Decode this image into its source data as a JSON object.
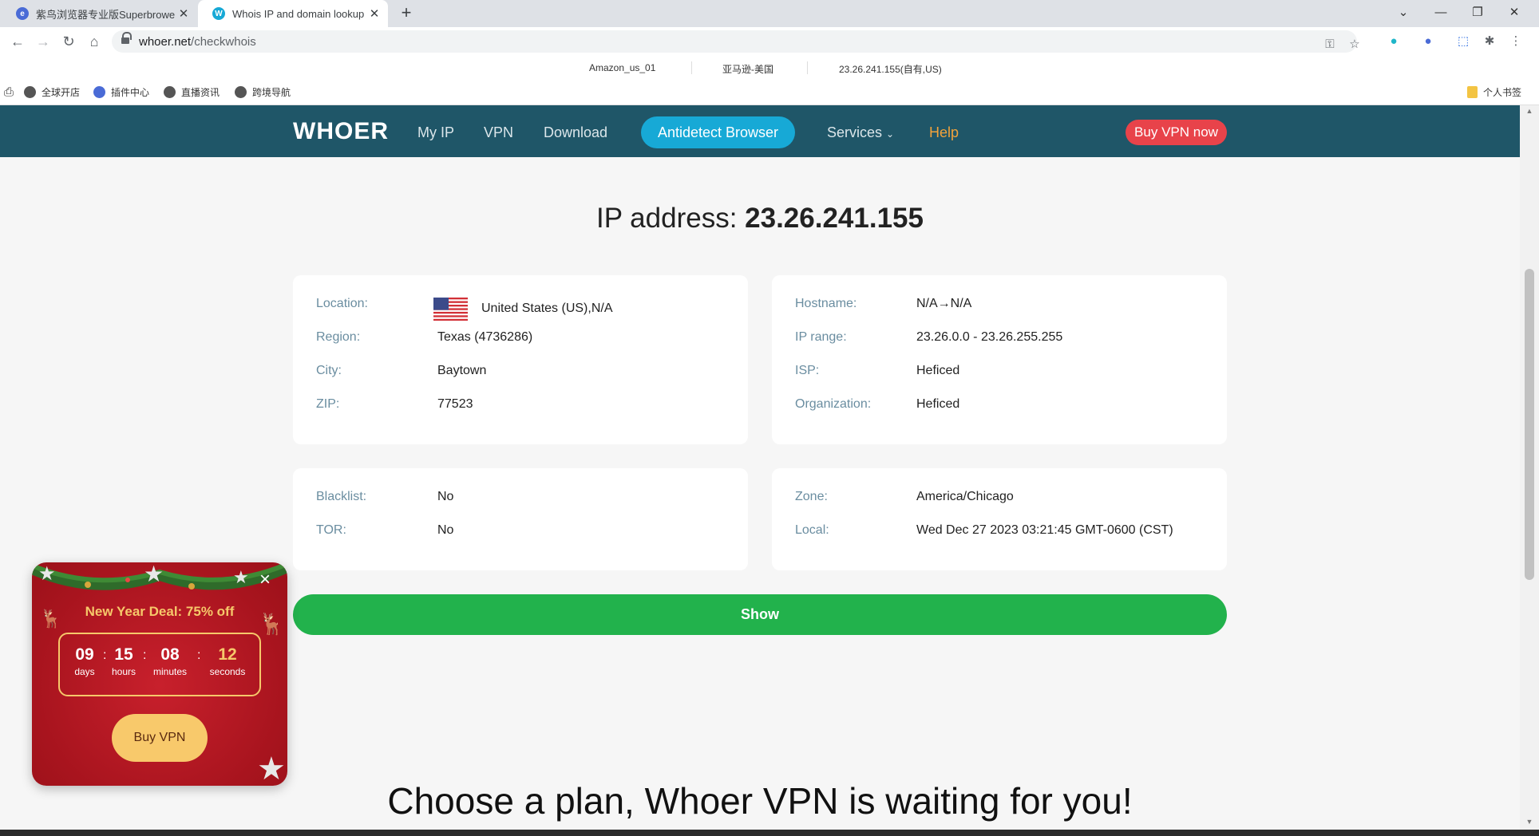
{
  "browser": {
    "tabs": [
      {
        "title": "紫鸟浏览器专业版Superbrower",
        "active": false
      },
      {
        "title": "Whois IP and domain lookup",
        "active": true
      }
    ],
    "url_host": "whoer.net",
    "url_path": "/checkwhois",
    "info_bar": {
      "account": "Amazon_us_01",
      "platform": "亚马逊-美国",
      "ip": "23.26.241.155(自有,US)"
    },
    "bookmarks": [
      "全球开店",
      "插件中心",
      "直播资讯",
      "跨境导航"
    ],
    "bookmark_folder": "个人书签"
  },
  "nav": {
    "logo": "WHOER",
    "links": [
      "My IP",
      "VPN",
      "Download"
    ],
    "antidetect": "Antidetect Browser",
    "services": "Services",
    "help": "Help",
    "buy": "Buy VPN now"
  },
  "ip": {
    "prefix": "IP address:",
    "value": "23.26.241.155"
  },
  "geo": [
    {
      "label": "Location:",
      "value": "United States (US),N/A"
    },
    {
      "label": "Region:",
      "value": "Texas (4736286)"
    },
    {
      "label": "City:",
      "value": "Baytown"
    },
    {
      "label": "ZIP:",
      "value": "77523"
    }
  ],
  "net": [
    {
      "label": "Hostname:",
      "value": "N/A→N/A"
    },
    {
      "label": "IP range:",
      "value": "23.26.0.0 - 23.26.255.255"
    },
    {
      "label": "ISP:",
      "value": "Heficed"
    },
    {
      "label": "Organization:",
      "value": "Heficed"
    }
  ],
  "lists": [
    {
      "label": "Blacklist:",
      "value": "No"
    },
    {
      "label": "TOR:",
      "value": "No"
    }
  ],
  "time": [
    {
      "label": "Zone:",
      "value": "America/Chicago"
    },
    {
      "label": "Local:",
      "value": "Wed Dec 27 2023 03:21:45 GMT-0600 (CST)"
    }
  ],
  "show_button": "Show",
  "plan_heading": "Choose a plan, Whoer VPN is waiting for you!",
  "promo": {
    "deal": "New Year Deal: 75% off",
    "timer": [
      {
        "num": "09",
        "unit": "days"
      },
      {
        "num": "15",
        "unit": "hours"
      },
      {
        "num": "08",
        "unit": "minutes"
      },
      {
        "num": "12",
        "unit": "seconds"
      }
    ],
    "buy": "Buy VPN"
  },
  "colors": {
    "nav_bg": "#1f5668",
    "accent": "#17a9d6",
    "show_green": "#22b24c",
    "buy_red": "#e8434a",
    "label_blue": "#6a8da0",
    "promo_red": "#b5161f",
    "promo_gold": "#f6c86a"
  }
}
